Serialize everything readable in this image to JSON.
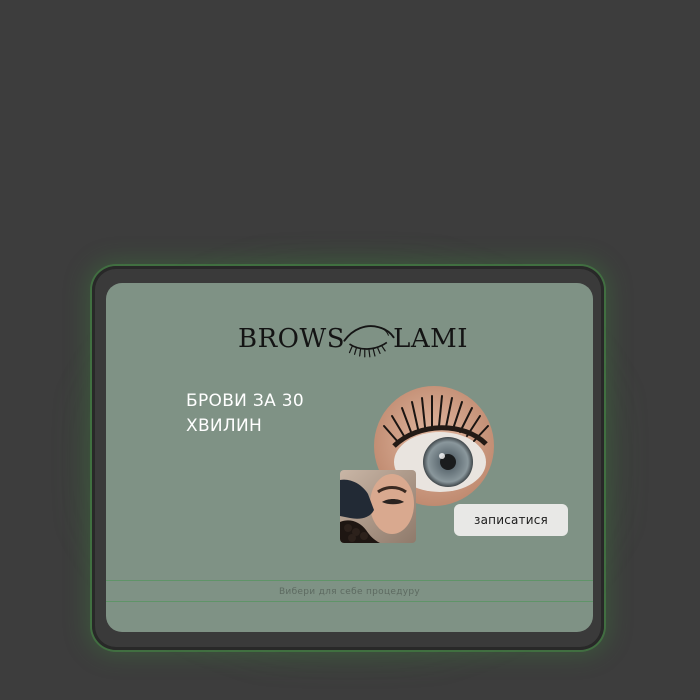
{
  "logo": {
    "left_word": "BROWS",
    "right_word": "LAMI"
  },
  "hero": {
    "headline_line1": "БРОВИ ЗА 30",
    "headline_line2": "ХВИЛИН"
  },
  "cta": {
    "label": "записатися"
  },
  "footer": {
    "caption": "Вибери для себе процедуру"
  },
  "colors": {
    "page_background": "#3d3d3d",
    "card_background": "#7f9285",
    "accent_glow": "#4a8c4a",
    "button_background": "#e8e8e6"
  },
  "icons": {
    "logo_mark": "closed-eye-brow-icon"
  }
}
